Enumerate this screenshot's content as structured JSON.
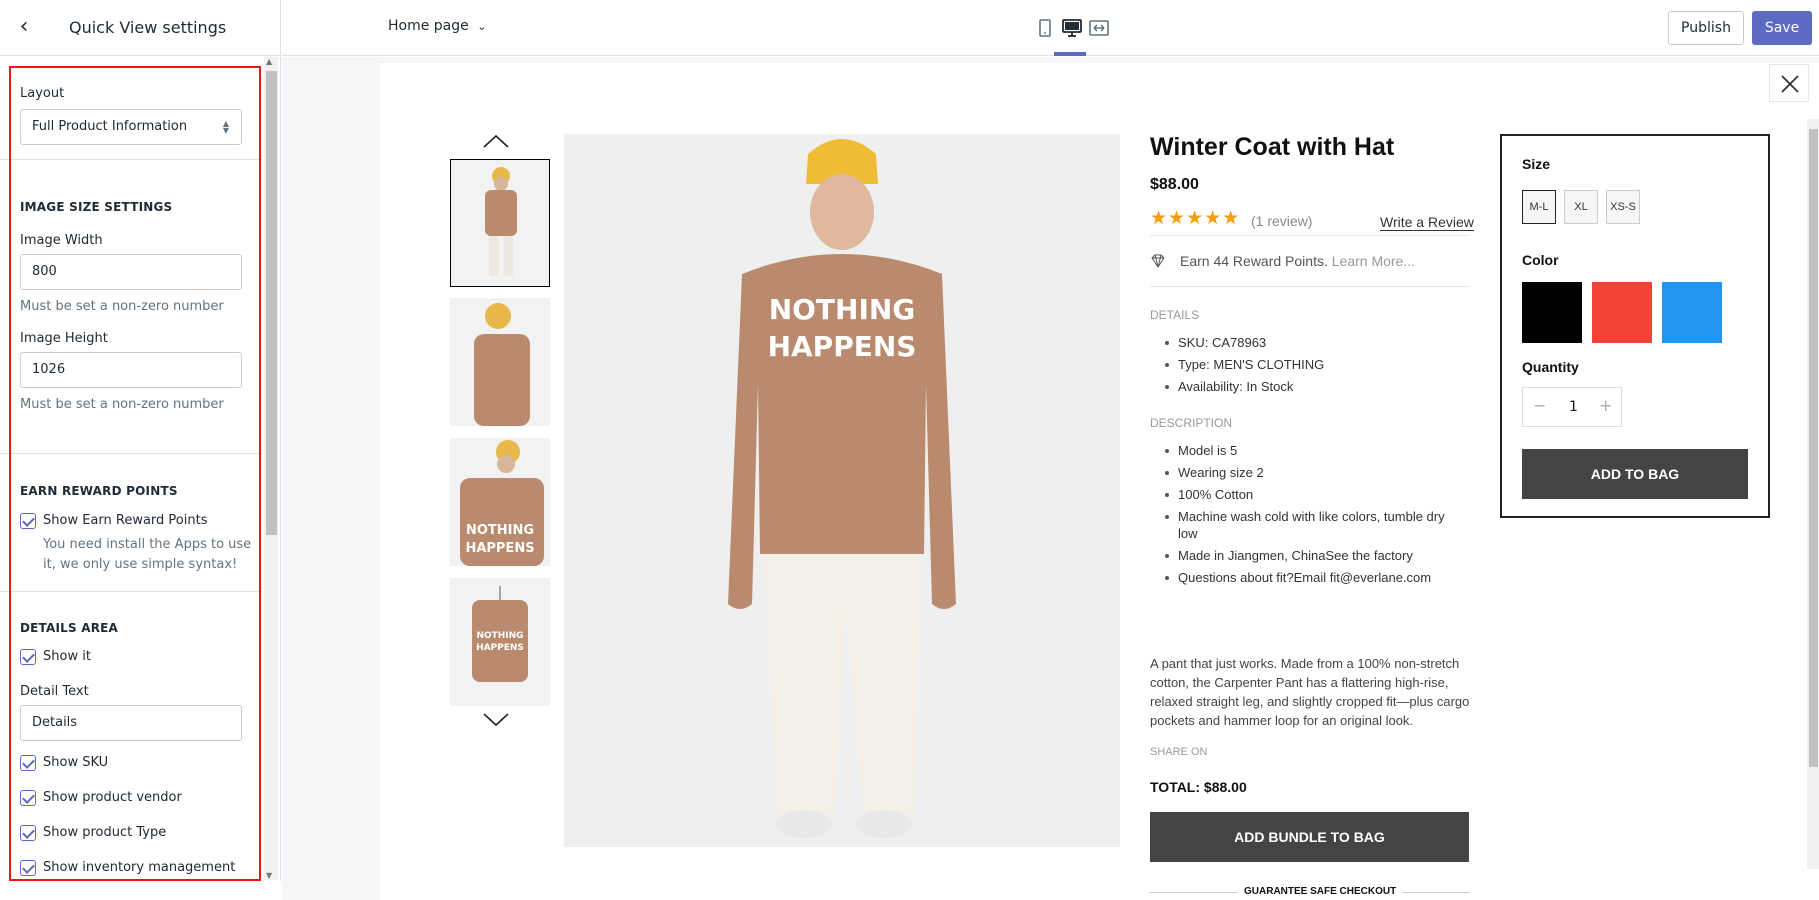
{
  "sidebar": {
    "title": "Quick View settings",
    "layout_label": "Layout",
    "layout_value": "Full Product Information",
    "image_size_heading": "IMAGE SIZE SETTINGS",
    "image_width_label": "Image Width",
    "image_width_value": "800",
    "image_width_help": "Must be set a non-zero number",
    "image_height_label": "Image Height",
    "image_height_value": "1026",
    "image_height_help": "Must be set a non-zero number",
    "reward_heading": "EARN REWARD POINTS",
    "reward_checkbox": "Show Earn Reward Points",
    "reward_help_1": "You need install the Apps to use",
    "reward_help_2": "it, we only use simple syntax!",
    "details_heading": "DETAILS AREA",
    "show_it": "Show it",
    "detail_text_label": "Detail Text",
    "detail_text_value": "Details",
    "show_sku": "Show SKU",
    "show_vendor": "Show product vendor",
    "show_type": "Show product Type",
    "show_inventory": "Show inventory management"
  },
  "topbar": {
    "page_selector": "Home page",
    "publish": "Publish",
    "save": "Save"
  },
  "product": {
    "title": "Winter Coat with Hat",
    "price": "$88.00",
    "stars": "★★★★★",
    "review_count": "(1 review)",
    "write_review": "Write a Review",
    "reward_text": "Earn 44 Reward Points.",
    "reward_link": "Learn More...",
    "details_heading": "DETAILS",
    "details": [
      "SKU: CA78963",
      "Type: MEN'S CLOTHING",
      "Availability: In Stock"
    ],
    "description_heading": "DESCRIPTION",
    "description_items": [
      "Model is 5",
      "Wearing size 2",
      "100% Cotton",
      "Machine wash cold with like colors, tumble dry",
      "low",
      "Made in Jiangmen, ChinaSee the factory",
      "Questions about fit?Email fit@everlane.com"
    ],
    "description_paragraph": "A pant that just works. Made from a 100% non-stretch cotton, the Carpenter Pant has a flattering high-rise, relaxed straight leg, and slightly cropped fit—plus cargo pockets and hammer loop for an original look.",
    "share_on": "SHARE ON",
    "total": "TOTAL: $88.00",
    "add_bundle": "ADD BUNDLE TO BAG",
    "guarantee": "GUARANTEE SAFE CHECKOUT",
    "hoodie_text_1": "NOTHING",
    "hoodie_text_2": "HAPPENS",
    "size_label": "Size",
    "sizes": [
      "M-L",
      "XL",
      "XS-S"
    ],
    "color_label": "Color",
    "colors": [
      "#000000",
      "#f44336",
      "#2196f3"
    ],
    "quantity_label": "Quantity",
    "quantity": "1",
    "qty_minus": "−",
    "qty_plus": "+",
    "add_to_bag": "ADD TO BAG"
  },
  "icons": {
    "back": "chevron-left-icon",
    "mobile": "mobile-icon",
    "desktop": "desktop-icon",
    "fullwidth": "full-width-icon",
    "close": "close-icon",
    "diamond": "diamond-icon"
  },
  "colors": {
    "accent": "#5c6ac4",
    "highlight_border": "#e81818",
    "button_dark": "#444444",
    "star": "#f59e0b"
  }
}
